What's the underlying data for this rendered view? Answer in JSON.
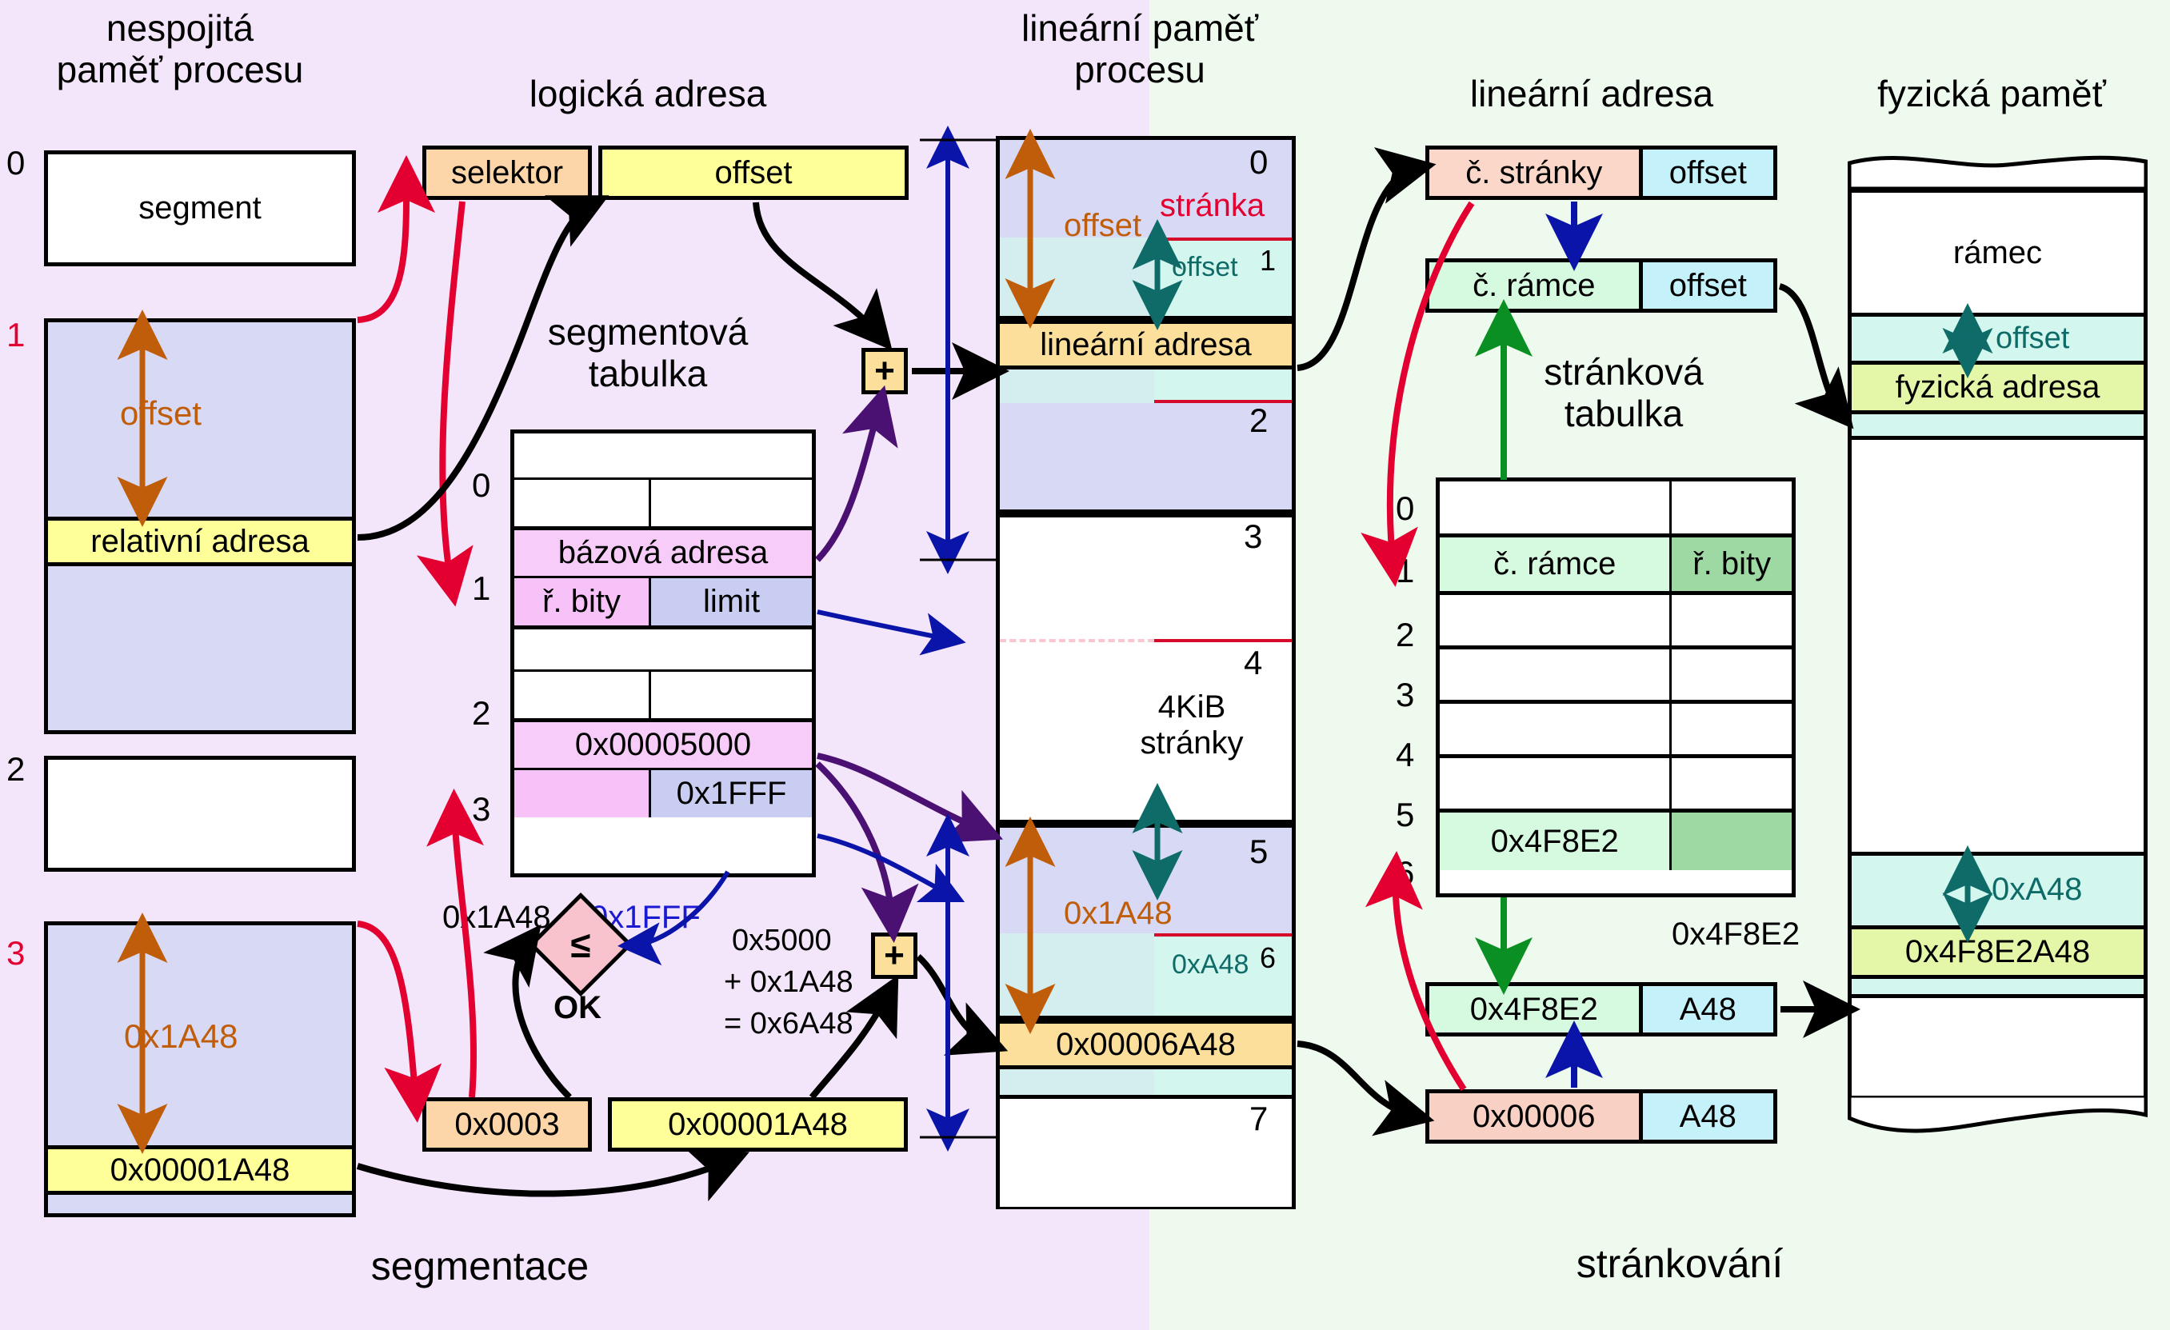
{
  "titles": {
    "noncontig_process_memory": "nespojitá\npaměť procesu",
    "logical_address": "logická adresa",
    "linear_process_memory": "lineární paměť\nprocesu",
    "linear_address": "lineární adresa",
    "physical_memory": "fyzická paměť",
    "segment_table": "segmentová\ntabulka",
    "page_table": "stránková\ntabulka"
  },
  "footers": {
    "left": "segmentace",
    "right": "stránkování"
  },
  "process_memory": {
    "indices": [
      "0",
      "1",
      "2",
      "3"
    ],
    "segment_label": "segment",
    "offset_label": "offset",
    "relative_address_label": "relativní adresa",
    "offset_value": "0x1A48",
    "relative_address_value": "0x00001A48"
  },
  "logical_address": {
    "selector_label": "selektor",
    "offset_label": "offset",
    "selector_value": "0x0003",
    "offset_value": "0x00001A48"
  },
  "segment_table": {
    "indices": [
      "0",
      "1",
      "2",
      "3"
    ],
    "row1": {
      "base": "bázová adresa",
      "rights": "ř. bity",
      "limit": "limit"
    },
    "row3": {
      "base": "0x00005000",
      "rights": "",
      "limit": "0x1FFF"
    }
  },
  "compare": {
    "left_value": "0x1A48",
    "right_value": "0x1FFF",
    "operator": "≤",
    "result": "OK"
  },
  "adder": {
    "symbol": "+",
    "line1": "0x5000",
    "line2": "+ 0x1A48",
    "line3": "= 0x6A48"
  },
  "linear_memory": {
    "page_indices": [
      "0",
      "1",
      "2",
      "3",
      "4",
      "5",
      "6",
      "7"
    ],
    "page_label": "stránka",
    "offset_big_label": "offset",
    "offset_small_label": "offset",
    "linear_address_label": "lineární adresa",
    "page_size_label": "4KiB\nstránky",
    "offset_big_value": "0x1A48",
    "offset_small_value": "0xA48",
    "linear_address_value": "0x00006A48"
  },
  "linear_address_fields": {
    "page_number_label": "č. stránky",
    "offset_label": "offset",
    "frame_number_label": "č. rámce",
    "frame_offset_label": "offset",
    "page_number_value": "0x00006",
    "offset_value": "A48",
    "frame_number_value": "0x4F8E2",
    "frame_offset_value": "A48"
  },
  "page_table": {
    "indices": [
      "0",
      "1",
      "2",
      "3",
      "4",
      "5",
      "6"
    ],
    "row1": {
      "frame": "č. rámce",
      "rights": "ř. bity"
    },
    "row6": {
      "frame": "0x4F8E2",
      "rights": ""
    }
  },
  "physical_memory": {
    "frame_label": "rámec",
    "offset_label": "offset",
    "physical_address_label": "fyzická adresa",
    "frame_value": "0x4F8E2",
    "offset_value": "0xA48",
    "physical_address_value": "0x4F8E2A48"
  },
  "colors": {
    "left_bg": "#f3e6fb",
    "right_bg": "#effaee",
    "red": "#e30030",
    "orange_arrow": "#c05d0a",
    "teal": "#0e6b68",
    "blue": "#0a14a8",
    "purple": "#4a1072",
    "green": "#0a8f22",
    "selector": "#fcd5a8",
    "offset_yellow": "#ffff99",
    "base_pink": "#f7ccf9",
    "limit_blue": "#c9cdf2",
    "linear_amber": "#fcdf9b",
    "frame_mint": "#c6f6c9",
    "offset_cyan": "#c5f1fb",
    "phys_lime": "#e4f7a8"
  }
}
